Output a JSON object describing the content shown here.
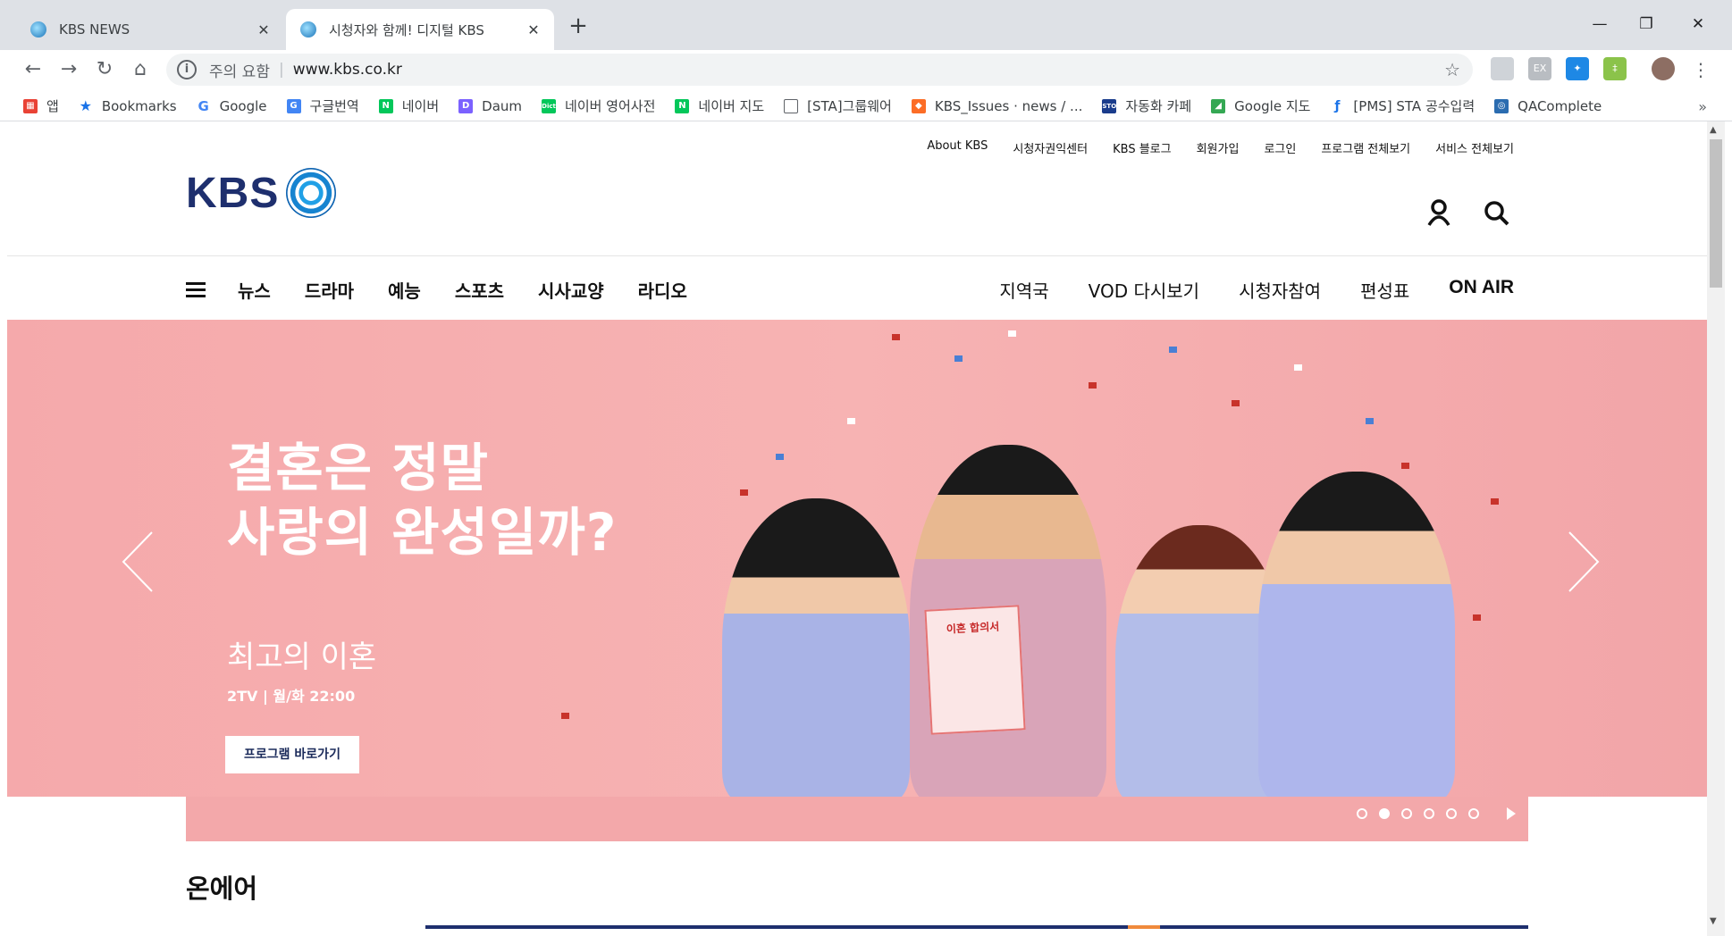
{
  "browser": {
    "tabs": [
      {
        "title": "KBS NEWS",
        "active": false
      },
      {
        "title": "시청자와 함께! 디지털 KBS",
        "active": true
      }
    ],
    "omnibox": {
      "security_text": "주의 요함",
      "url": "www.kbs.co.kr"
    },
    "bookmarks": [
      {
        "label": "앱",
        "icon": "apps-grid-icon"
      },
      {
        "label": "Bookmarks",
        "icon": "star-icon"
      },
      {
        "label": "Google",
        "icon": "google-icon"
      },
      {
        "label": "구글번역",
        "icon": "translate-icon"
      },
      {
        "label": "네이버",
        "icon": "naver-icon"
      },
      {
        "label": "Daum",
        "icon": "daum-icon"
      },
      {
        "label": "네이버 영어사전",
        "icon": "dict-icon"
      },
      {
        "label": "네이버 지도",
        "icon": "naver-icon"
      },
      {
        "label": "[STA]그룹웨어",
        "icon": "page-icon"
      },
      {
        "label": "KBS_Issues · news / ...",
        "icon": "gitlab-icon"
      },
      {
        "label": "자동화 카페",
        "icon": "stop-icon"
      },
      {
        "label": "Google 지도",
        "icon": "maps-icon"
      },
      {
        "label": "[PMS] STA 공수입력",
        "icon": "pms-icon"
      },
      {
        "label": "QAComplete",
        "icon": "qa-icon"
      }
    ],
    "bookmarks_more": "»"
  },
  "site": {
    "utility_links": [
      "About KBS",
      "시청자권익센터",
      "KBS 블로그",
      "회원가입",
      "로그인",
      "프로그램 전체보기",
      "서비스 전체보기"
    ],
    "logo_text": "KBS",
    "gnb_left": [
      "뉴스",
      "드라마",
      "예능",
      "스포츠",
      "시사교양",
      "라디오"
    ],
    "gnb_right": [
      "지역국",
      "VOD 다시보기",
      "시청자참여",
      "편성표"
    ],
    "gnb_onair": "ON AIR",
    "hero": {
      "title_line1": "결혼은 정말",
      "title_line2": "사랑의 완성일까?",
      "program": "최고의 이혼",
      "meta": "2TV  |  월/화 22:00",
      "cta": "프로그램 바로가기",
      "card_title": "이혼 합의서",
      "slides_total": 6,
      "current_slide": 1
    },
    "section_onair": "온에어"
  }
}
